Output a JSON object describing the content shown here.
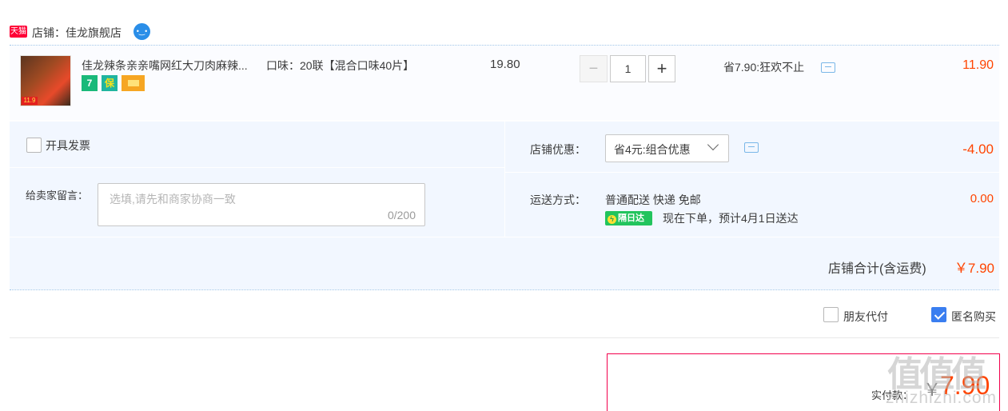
{
  "shop": {
    "badge": "天猫",
    "name": "店铺：佳龙旗舰店",
    "chat_icon": "wangwang-icon"
  },
  "product": {
    "thumb_tag": "11.9",
    "title": "佳龙辣条亲亲嘴网红大刀肉麻辣...",
    "sku": "口味：20联【混合口味40片】",
    "service_icons": [
      "7",
      "保",
      "卡"
    ],
    "unit_price": "19.80",
    "quantity": "1",
    "qty_minus": "−",
    "qty_plus": "+",
    "promotion": "省7.90:狂欢不止",
    "subtotal": "11.90"
  },
  "invoice": {
    "label": "开具发票",
    "checked": false
  },
  "message": {
    "label": "给卖家留言：",
    "placeholder": "选填,请先和商家协商一致",
    "counter": "0/200"
  },
  "shop_discount": {
    "label": "店铺优惠：",
    "selected": "省4元:组合优惠",
    "amount": "-4.00"
  },
  "shipping": {
    "label": "运送方式：",
    "method": "普通配送 快递 免邮",
    "badge": "隔日达",
    "eta": "现在下单，预计4月1日送达",
    "fee": "0.00"
  },
  "shop_total": {
    "label": "店铺合计(含运费)",
    "amount": "￥7.90"
  },
  "options": {
    "friend_pay": {
      "label": "朋友代付",
      "checked": false
    },
    "anonymous": {
      "label": "匿名购买",
      "checked": true
    }
  },
  "payment": {
    "label": "实付款：",
    "currency": "￥",
    "amount": "7.90"
  },
  "watermark": {
    "logo": "值值值",
    "text": "zhizhizhi.com"
  },
  "colors": {
    "accent": "#ff4400",
    "brand": "#ff0036",
    "panel": "#f2f7ff",
    "check": "#3a7ef0"
  }
}
